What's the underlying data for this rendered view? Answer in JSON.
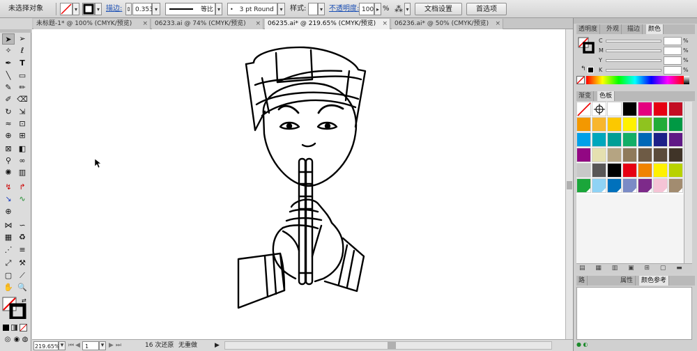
{
  "control_bar": {
    "selection_label": "未选择对象",
    "stroke_label": "描边:",
    "stroke_value": "0.353",
    "profile_label": "等比",
    "brush_value": "3 pt Round",
    "style_label": "样式:",
    "opacity_label": "不透明度:",
    "opacity_value": "100",
    "opacity_unit": "%",
    "doc_setup_button": "文档设置",
    "preferences_button": "首选项"
  },
  "tabs": [
    {
      "label": "未标题-1* @ 100% (CMYK/预览)",
      "active": false
    },
    {
      "label": "06233.ai @ 74% (CMYK/预览)",
      "active": false
    },
    {
      "label": "06235.ai* @ 219.65% (CMYK/预览)",
      "active": true
    },
    {
      "label": "06236.ai* @ 50% (CMYK/预览)",
      "active": false
    }
  ],
  "tab_close": "×",
  "status_bar": {
    "zoom": "219.65%",
    "page": "1",
    "undo_status": "16 次还原",
    "redo_status": "无重做"
  },
  "panels": {
    "top_tabs": [
      "透明度",
      "外观",
      "描边",
      "颜色"
    ],
    "cmyk_labels": [
      "C",
      "M",
      "Y",
      "K"
    ],
    "percent": "%",
    "swatch_tabs": [
      "渐变",
      "色板"
    ],
    "bottom_tabs": [
      "路",
      "属性",
      "颜色参考"
    ]
  },
  "swatches": [
    [
      "none",
      "register",
      "#ffffff",
      "#000000",
      "#e4007f",
      "#e60012",
      "#c30d23"
    ],
    [
      "#f39800",
      "#f8b62d",
      "#fcc800",
      "#fff100",
      "#8fc31f",
      "#22ac38",
      "#009944"
    ],
    [
      "#00a0e9",
      "#00a7bc",
      "#009e96",
      "#13ae67",
      "#0068b7",
      "#1d2088",
      "#601986"
    ],
    [
      "#920783",
      "#e5e0b0",
      "#b5a482",
      "#8f7a5b",
      "#6e5b45",
      "#5b4b3a",
      "#403428"
    ],
    [
      "#c8c8c8",
      "#595757",
      "#000000",
      "#e60012",
      "#f08300",
      "#fff100",
      "#b8d200"
    ],
    [
      "#1aa63a",
      "#8fd3f5",
      "#0071bc",
      "#7b8bc6",
      "#7d2a8a",
      "#f5c4d6",
      "#a28c70"
    ]
  ]
}
